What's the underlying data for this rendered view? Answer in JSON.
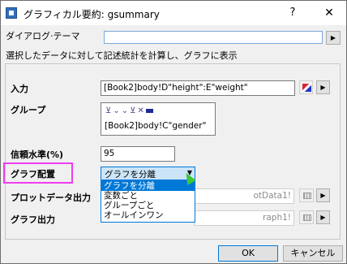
{
  "titlebar": {
    "title": "グラフィカル要約: gsummary",
    "help": "?",
    "close": "✕"
  },
  "theme": {
    "label": "ダイアログ·テーマ",
    "value": "",
    "button": "▶"
  },
  "description": "選択したデータに対して記述統計を計算し、グラフに表示",
  "fields": {
    "input": {
      "label": "入力",
      "value": "[Book2]body!D\"height\":E\"weight\""
    },
    "group": {
      "label": "グループ",
      "value": "[Book2]body!C\"gender\""
    },
    "confidence": {
      "label": "信頼水準(%)",
      "value": "95"
    },
    "layout": {
      "label": "グラフ配置",
      "value": "グラフを分離"
    },
    "plot_output": {
      "label": "プロットデータ出力",
      "value": "otData1!"
    },
    "graph_output": {
      "label": "グラフ出力",
      "value": "raph1!"
    }
  },
  "dropdown": {
    "options": [
      "グラフを分離",
      "変数ごと",
      "グループごと",
      "オールインワン"
    ],
    "selected_index": 0
  },
  "buttons": {
    "ok": "OK",
    "cancel": "キャンセル"
  },
  "colors": {
    "highlight": "#f03cf0",
    "accent": "#0078d7"
  }
}
